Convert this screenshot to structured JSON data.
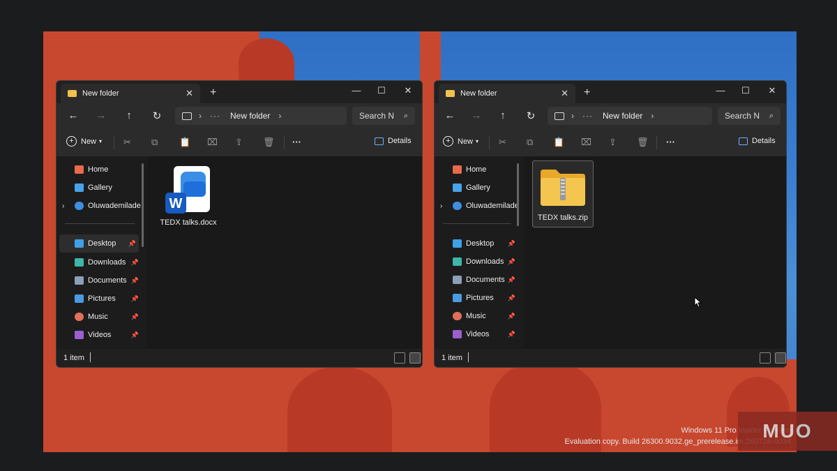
{
  "desktop": {
    "watermark_line1": "Windows 11 Pro Insider Preview",
    "watermark_line2": "Evaluation copy. Build 26300.9032.ge_prerelease.im.260726-0034",
    "logo_text": "MUO"
  },
  "windows": [
    {
      "tab_title": "New folder",
      "breadcrumb": "New folder",
      "search_placeholder": "Search N",
      "toolbar": {
        "new_label": "New",
        "details_label": "Details"
      },
      "sidebar": {
        "home": "Home",
        "gallery": "Gallery",
        "onedrive": "Oluwademilade",
        "desktop": "Desktop",
        "downloads": "Downloads",
        "documents": "Documents",
        "pictures": "Pictures",
        "music": "Music",
        "videos": "Videos"
      },
      "file": {
        "name": "TEDX talks.docx",
        "icon": "word-document-icon"
      },
      "status": "1 item"
    },
    {
      "tab_title": "New folder",
      "breadcrumb": "New folder",
      "search_placeholder": "Search N",
      "toolbar": {
        "new_label": "New",
        "details_label": "Details"
      },
      "sidebar": {
        "home": "Home",
        "gallery": "Gallery",
        "onedrive": "Oluwademilade",
        "desktop": "Desktop",
        "downloads": "Downloads",
        "documents": "Documents",
        "pictures": "Pictures",
        "music": "Music",
        "videos": "Videos"
      },
      "file": {
        "name": "TEDX talks.zip",
        "icon": "zip-folder-icon"
      },
      "status": "1 item"
    }
  ],
  "colors": {
    "folder": "#f2c14e",
    "accent": "#6fb3ff",
    "word_blue": "#185abd"
  }
}
